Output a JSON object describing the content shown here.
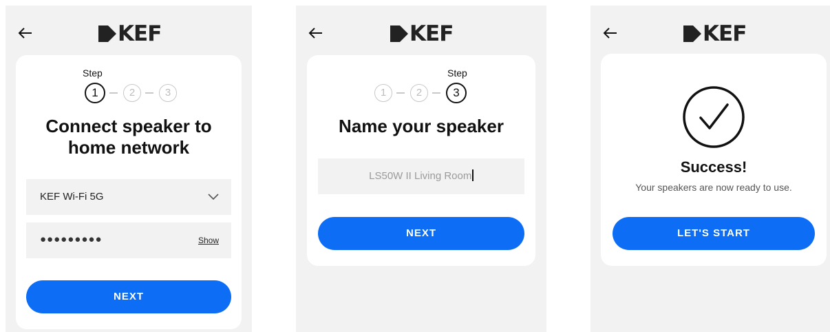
{
  "brand": {
    "logo_text": "KEF"
  },
  "screen1": {
    "step_label": "Step",
    "steps": [
      "1",
      "2",
      "3"
    ],
    "title_line1": "Connect speaker to",
    "title_line2": "home network",
    "network_value": "KEF Wi-Fi 5G",
    "password_mask": "●●●●●●●●●",
    "show_label": "Show",
    "next_label": "NEXT"
  },
  "screen2": {
    "step_label": "Step",
    "steps": [
      "1",
      "2",
      "3"
    ],
    "title": "Name your speaker",
    "name_value": "LS50W II Living Room",
    "next_label": "NEXT"
  },
  "screen3": {
    "title": "Success!",
    "subtitle": "Your speakers are now ready to use.",
    "start_label": "LET'S START"
  },
  "colors": {
    "accent": "#0d6ef5",
    "field_bg": "#f2f2f2",
    "panel_bg": "#f2f2f2"
  }
}
